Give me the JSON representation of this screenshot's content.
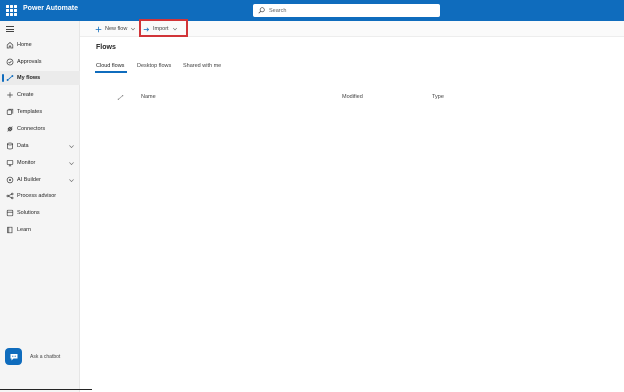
{
  "app": {
    "title": "Power Automate"
  },
  "search": {
    "placeholder": "Search"
  },
  "sidebar": {
    "items": [
      {
        "label": "Home",
        "icon": "home-icon"
      },
      {
        "label": "Approvals",
        "icon": "approvals-icon"
      },
      {
        "label": "My flows",
        "icon": "flow-icon",
        "active": true
      },
      {
        "label": "Create",
        "icon": "plus-icon"
      },
      {
        "label": "Templates",
        "icon": "templates-icon"
      },
      {
        "label": "Connectors",
        "icon": "connectors-icon"
      },
      {
        "label": "Data",
        "icon": "data-icon",
        "expandable": true
      },
      {
        "label": "Monitor",
        "icon": "monitor-icon",
        "expandable": true
      },
      {
        "label": "AI Builder",
        "icon": "ai-builder-icon",
        "expandable": true
      },
      {
        "label": "Process advisor",
        "icon": "process-advisor-icon"
      },
      {
        "label": "Solutions",
        "icon": "solutions-icon"
      },
      {
        "label": "Learn",
        "icon": "learn-icon"
      }
    ],
    "chatbot_label": "Ask a chatbot"
  },
  "toolbar": {
    "new_flow_label": "New flow",
    "import_label": "Import"
  },
  "page": {
    "title": "Flows"
  },
  "tabs": [
    {
      "label": "Cloud flows",
      "selected": true
    },
    {
      "label": "Desktop flows",
      "selected": false
    },
    {
      "label": "Shared with me",
      "selected": false
    }
  ],
  "table": {
    "columns": [
      "Name",
      "Modified",
      "Type"
    ]
  },
  "colors": {
    "brand": "#0f6cbd",
    "highlight": "#d13438"
  }
}
